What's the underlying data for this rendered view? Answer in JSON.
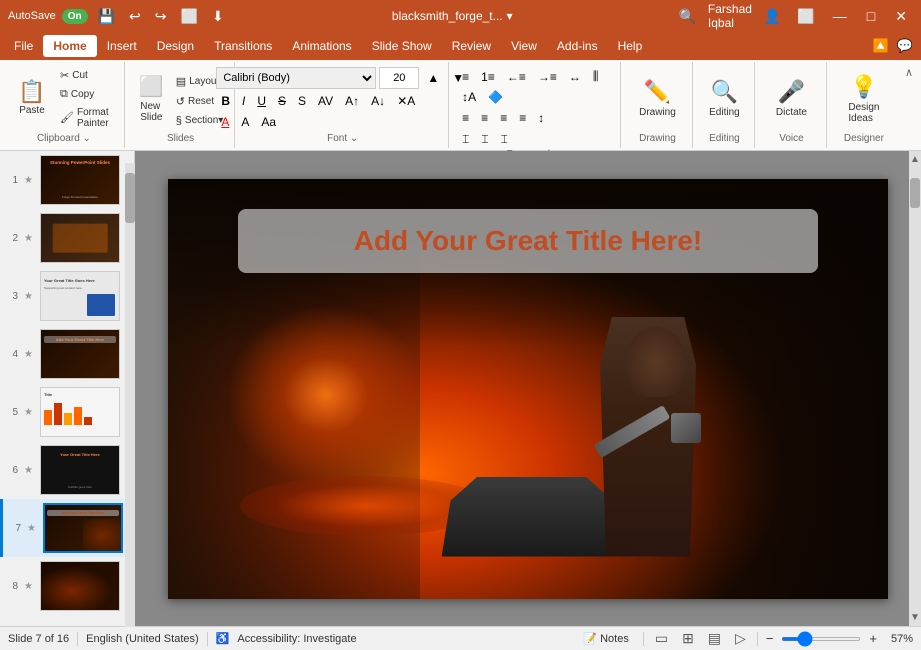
{
  "titleBar": {
    "autosave": "AutoSave",
    "autosaveState": "On",
    "docTitle": "blacksmith_forge_t...",
    "dropdownArrow": "▾",
    "user": "Farshad Iqbal",
    "icons": [
      "💾",
      "↩",
      "↪",
      "⬜",
      "⬇"
    ]
  },
  "menuBar": {
    "items": [
      "File",
      "Home",
      "Insert",
      "Design",
      "Transitions",
      "Animations",
      "Slide Show",
      "Review",
      "View",
      "Add-ins",
      "Help"
    ],
    "activeItem": "Home",
    "helpIcons": [
      "🔼",
      "💬"
    ]
  },
  "ribbon": {
    "clipboard": {
      "label": "Clipboard",
      "paste": "Paste",
      "cut": "✂",
      "copy": "📋",
      "formatPainter": "🖌"
    },
    "slides": {
      "label": "Slides",
      "newSlide": "New\nSlide"
    },
    "font": {
      "label": "Font",
      "fontName": "Calibri (Body)",
      "fontSize": "20",
      "bold": "B",
      "italic": "I",
      "underline": "U",
      "strikethrough": "S",
      "shadow": "S",
      "fontColor": "A"
    },
    "paragraph": {
      "label": "Paragraph"
    },
    "drawing": {
      "label": "Drawing",
      "btnLabel": "Drawing"
    },
    "editing": {
      "label": "Editing",
      "btnLabel": "Editing"
    },
    "voice": {
      "label": "Voice",
      "dictate": "Dictate"
    },
    "designer": {
      "label": "Designer",
      "btnLabel": "Design\nIdeas"
    }
  },
  "slides": [
    {
      "num": "1",
      "star": "★",
      "type": "title-dark",
      "title": "Stunning PowerPoint Slides"
    },
    {
      "num": "2",
      "star": "★",
      "type": "dark-warm",
      "title": ""
    },
    {
      "num": "3",
      "star": "★",
      "type": "dark-text",
      "title": "Your Great Title Goes Here"
    },
    {
      "num": "4",
      "star": "★",
      "type": "dark-title2",
      "title": "Add Your Great Title Here"
    },
    {
      "num": "5",
      "star": "★",
      "type": "light-chart",
      "title": ""
    },
    {
      "num": "6",
      "star": "★",
      "type": "dark-text2",
      "title": "Your Great Title Here"
    },
    {
      "num": "7",
      "star": "★",
      "type": "forge-active",
      "title": "Add Your Great Title Here",
      "active": true
    },
    {
      "num": "8",
      "star": "★",
      "type": "dark-forge2",
      "title": ""
    }
  ],
  "slideCanvas": {
    "titleText": "Add Your Great Title Here!"
  },
  "statusBar": {
    "slideInfo": "Slide 7 of 16",
    "language": "English (United States)",
    "accessibility": "Accessibility: Investigate",
    "notes": "Notes",
    "zoom": "57%",
    "viewIcons": [
      "▭",
      "⊞",
      "▤",
      "⊕"
    ]
  }
}
